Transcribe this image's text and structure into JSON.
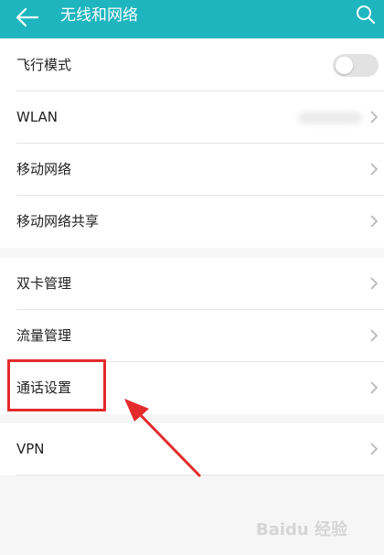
{
  "header": {
    "title": "无线和网络",
    "back_icon": "arrow-left-icon",
    "search_icon": "search-icon",
    "background": "#1fb5bf"
  },
  "group1": [
    {
      "label": "飞行模式",
      "control": "toggle",
      "toggle_on": false
    },
    {
      "label": "WLAN",
      "control": "chevron",
      "value_blurred": true
    },
    {
      "label": "移动网络",
      "control": "chevron"
    },
    {
      "label": "移动网络共享",
      "control": "chevron"
    }
  ],
  "group2": [
    {
      "label": "双卡管理",
      "control": "chevron"
    },
    {
      "label": "流量管理",
      "control": "chevron"
    },
    {
      "label": "通话设置",
      "control": "chevron"
    }
  ],
  "group3": [
    {
      "label": "VPN",
      "control": "chevron"
    }
  ],
  "annotation": {
    "color": "#e32b2b",
    "highlighted_item": "通话设置"
  },
  "watermark": "Baidu 经验"
}
